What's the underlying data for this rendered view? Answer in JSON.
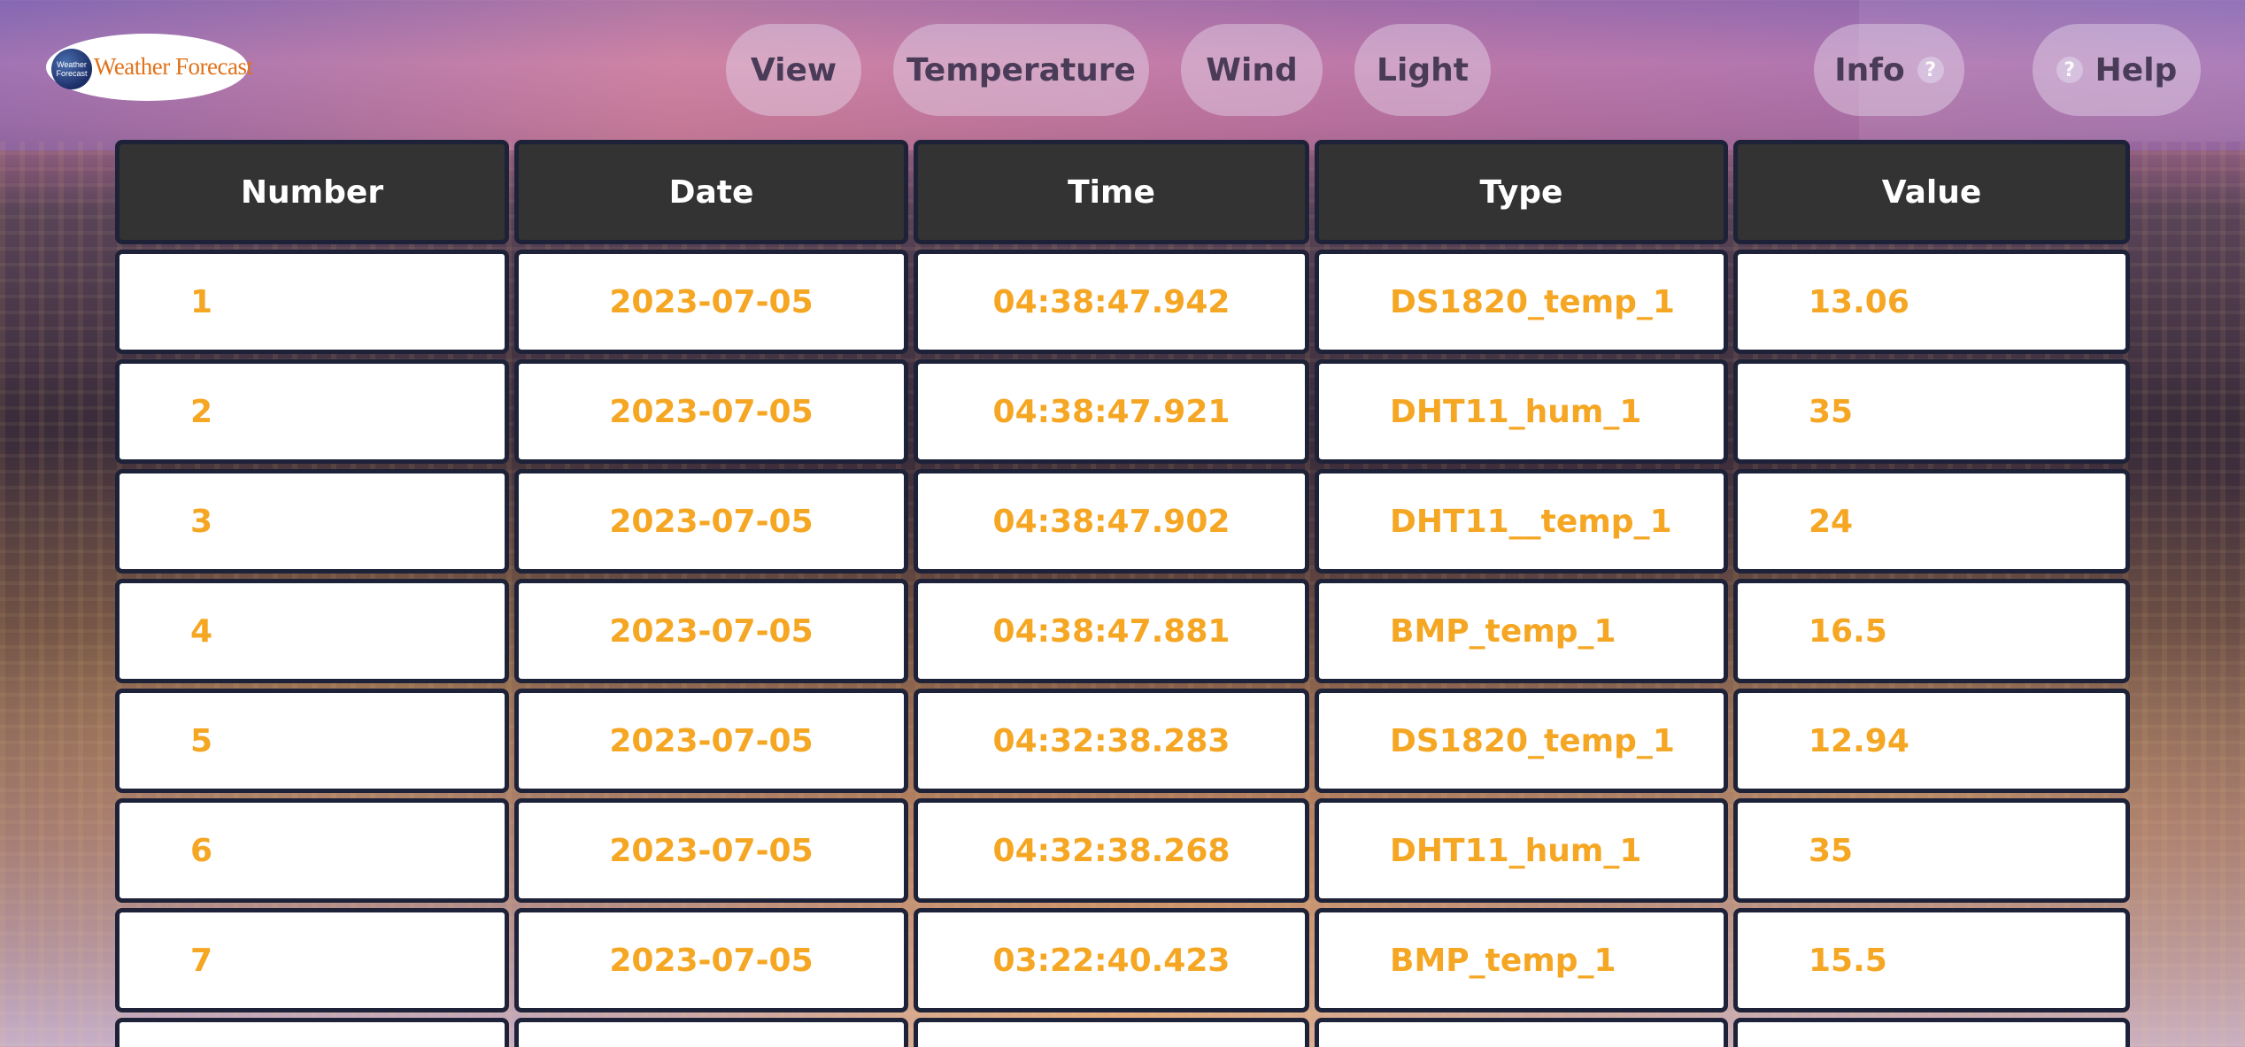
{
  "app": {
    "logo_text": "Weather Forecast",
    "logo_globe_line1": "Weather",
    "logo_globe_line2": "Forecast"
  },
  "nav": {
    "view": "View",
    "temperature": "Temperature",
    "wind": "Wind",
    "light": "Light",
    "info": "Info",
    "help": "Help",
    "question_glyph": "?"
  },
  "table": {
    "headers": [
      "Number",
      "Date",
      "Time",
      "Type",
      "Value"
    ],
    "rows": [
      {
        "number": "1",
        "date": "2023-07-05",
        "time": "04:38:47.942",
        "type": "DS1820_temp_1",
        "value": "13.06"
      },
      {
        "number": "2",
        "date": "2023-07-05",
        "time": "04:38:47.921",
        "type": "DHT11_hum_1",
        "value": "35"
      },
      {
        "number": "3",
        "date": "2023-07-05",
        "time": "04:38:47.902",
        "type": "DHT11__temp_1",
        "value": "24"
      },
      {
        "number": "4",
        "date": "2023-07-05",
        "time": "04:38:47.881",
        "type": "BMP_temp_1",
        "value": "16.5"
      },
      {
        "number": "5",
        "date": "2023-07-05",
        "time": "04:32:38.283",
        "type": "DS1820_temp_1",
        "value": "12.94"
      },
      {
        "number": "6",
        "date": "2023-07-05",
        "time": "04:32:38.268",
        "type": "DHT11_hum_1",
        "value": "35"
      },
      {
        "number": "7",
        "date": "2023-07-05",
        "time": "03:22:40.423",
        "type": "BMP_temp_1",
        "value": "15.5"
      }
    ]
  },
  "colors": {
    "header_bg": "#333333",
    "cell_text": "#f5a623",
    "cell_border": "#1d2238",
    "logo_text": "#e0721a"
  },
  "icons": {
    "info": "question-circle-icon",
    "help": "question-circle-icon"
  }
}
